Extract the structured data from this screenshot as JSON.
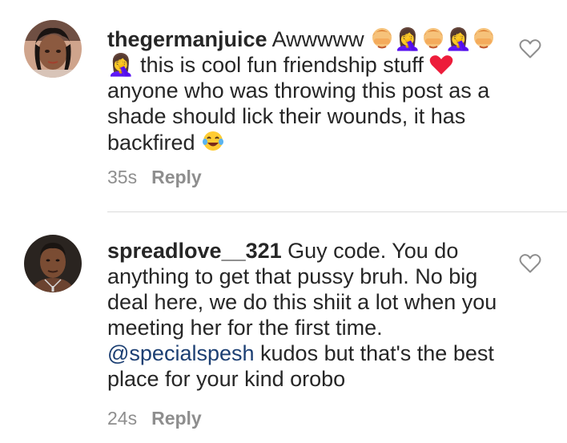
{
  "comments": [
    {
      "username": "thegermanjuice",
      "text_part1": " Awwwww ",
      "glyph_between": "🤦‍♀️",
      "text_part2": " this is cool fun friendship stuff ",
      "text_part3": " anyone who was throwing this post as a shade should lick their wounds, it has backfired ",
      "time": "35s",
      "reply_label": "Reply",
      "avatar_icon": "woman-avatar",
      "emojis": [
        "woman-facepalming-emoji",
        "red-heart-emoji",
        "face-with-tears-of-joy-emoji"
      ]
    },
    {
      "username": "spreadlove__321",
      "text_part1": " Guy code. You do anything to get that pussy bruh. No big deal here, we do this shiit a lot when you meeting her for the first time. ",
      "mention": "@specialspesh",
      "text_part2": " kudos but that's the best place for your kind orobo",
      "time": "24s",
      "reply_label": "Reply",
      "avatar_icon": "man-avatar"
    }
  ],
  "colors": {
    "text": "#262626",
    "muted": "#8e8e8e",
    "mention": "#1c3f73",
    "heart": "#ed1c3a",
    "divider": "#dbdbdb"
  }
}
